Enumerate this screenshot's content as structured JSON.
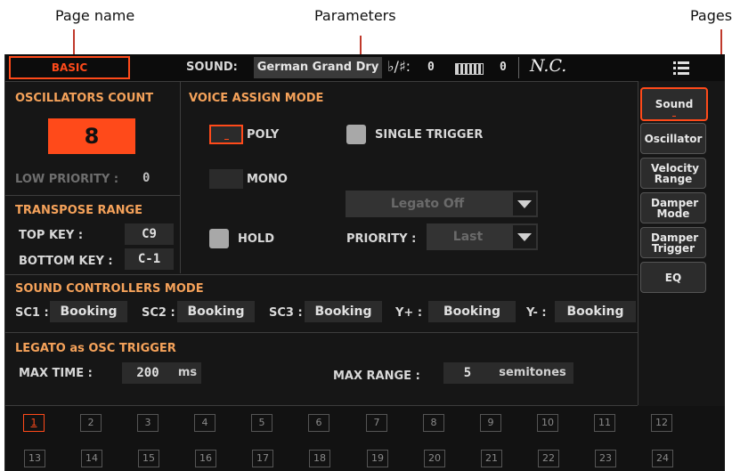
{
  "callouts": {
    "page_name": "Page name",
    "parameters": "Parameters",
    "pages": "Pages"
  },
  "topbar": {
    "page_name": "BASIC",
    "sound_label": "SOUND:",
    "sound_value": "German Grand Dry",
    "key_sig_symbol": "♭/♯:",
    "key_sig_value": "0",
    "octave_value": "0",
    "chord": "N.C."
  },
  "osc_count": {
    "title": "OSCILLATORS COUNT",
    "value": "8",
    "low_priority_label": "LOW PRIORITY :",
    "low_priority_value": "0"
  },
  "transpose": {
    "title": "TRANSPOSE RANGE",
    "top_key_label": "TOP KEY :",
    "top_key_value": "C9",
    "bottom_key_label": "BOTTOM KEY :",
    "bottom_key_value": "C-1"
  },
  "voice_assign": {
    "title": "VOICE ASSIGN MODE",
    "poly": "POLY",
    "mono": "MONO",
    "hold": "HOLD",
    "single_trigger": "SINGLE TRIGGER",
    "legato_value": "Legato Off",
    "priority_label": "PRIORITY :",
    "priority_value": "Last"
  },
  "sc_mode": {
    "title": "SOUND CONTROLLERS MODE",
    "items": [
      {
        "label": "SC1 :",
        "value": "Booking"
      },
      {
        "label": "SC2 :",
        "value": "Booking"
      },
      {
        "label": "SC3 :",
        "value": "Booking"
      },
      {
        "label": "Y+ :",
        "value": "Booking"
      },
      {
        "label": "Y- :",
        "value": "Booking"
      }
    ]
  },
  "legato": {
    "title": "LEGATO as OSC TRIGGER",
    "max_time_label": "MAX TIME :",
    "max_time_value": "200",
    "max_time_unit": "ms",
    "max_range_label": "MAX RANGE :",
    "max_range_value": "5",
    "max_range_unit": "semitones"
  },
  "pages": [
    "Sound",
    "Oscillator",
    "Velocity Range",
    "Damper Mode",
    "Damper Trigger",
    "EQ"
  ],
  "tracks": [
    "1",
    "2",
    "3",
    "4",
    "5",
    "6",
    "7",
    "8",
    "9",
    "10",
    "11",
    "12",
    "13",
    "14",
    "15",
    "16",
    "17",
    "18",
    "19",
    "20",
    "21",
    "22",
    "23",
    "24"
  ],
  "colors": {
    "accent": "#ff4a1a",
    "header_text": "#f5a25a",
    "panel_bg": "#161616"
  }
}
